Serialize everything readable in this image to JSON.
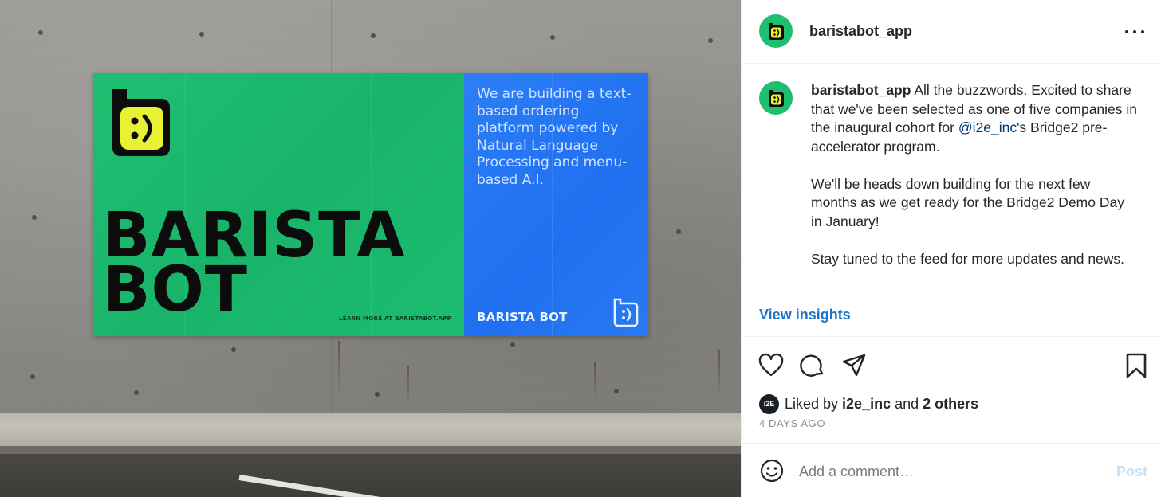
{
  "post_image": {
    "poster": {
      "headline_line1": "BARISTA",
      "headline_line2": "BOT",
      "learn_more": "LEARN MORE AT BARISTABOT.APP",
      "tagline": "We are building a text-based ordering platform powered by Natural Language Processing and menu-based A.I.",
      "brand": "BARISTA BOT"
    },
    "colors": {
      "green": "#1fbf72",
      "blue": "#2b7bf5",
      "logo_yellow": "#e8f233"
    }
  },
  "header": {
    "username": "baristabot_app",
    "avatar_icon": "baristabot-logo-icon",
    "more_icon": "more-options-icon"
  },
  "caption": {
    "username": "baristabot_app",
    "text_1": " All the buzzwords. Excited to share that we've been selected as one of five companies in the inaugural cohort for ",
    "mention": "@i2e_inc",
    "text_2": "'s Bridge2 pre-accelerator program.",
    "paragraph_2": "We'll be heads down building for the next few months as we get ready for the Bridge2 Demo Day in January!",
    "paragraph_3": "Stay tuned to the feed for more updates and news."
  },
  "insights": {
    "label": "View insights"
  },
  "actions": {
    "like_icon": "heart-icon",
    "comment_icon": "comment-icon",
    "share_icon": "share-icon",
    "save_icon": "bookmark-icon"
  },
  "likes": {
    "avatar_text": "i2E",
    "prefix": "Liked by ",
    "user": "i2e_inc",
    "middle": " and ",
    "others": "2 others"
  },
  "timestamp": "4 DAYS AGO",
  "comment": {
    "placeholder": "Add a comment…",
    "post_label": "Post",
    "emoji_icon": "emoji-icon"
  }
}
